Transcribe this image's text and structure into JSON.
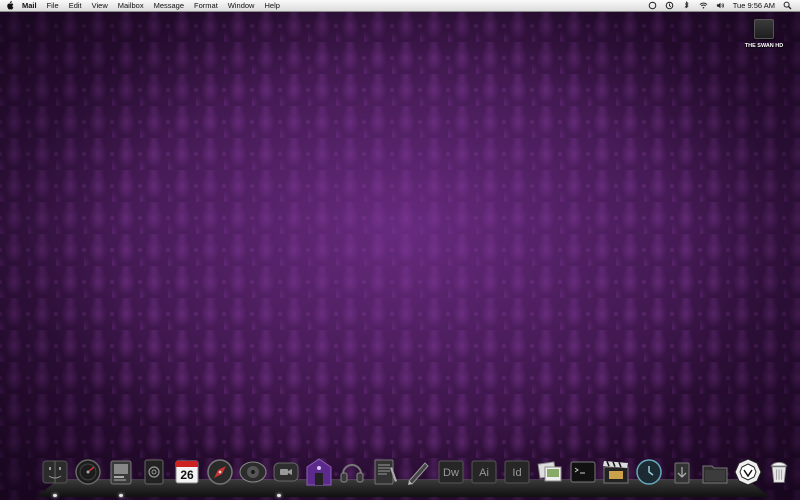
{
  "menubar": {
    "app_name": "Mail",
    "menus": [
      "File",
      "Edit",
      "View",
      "Mailbox",
      "Message",
      "Format",
      "Window",
      "Help"
    ],
    "status": {
      "datetime": "Tue 9:56 AM",
      "icons": [
        "sync-icon",
        "time-machine-icon",
        "bluetooth-icon",
        "wifi-icon",
        "volume-icon",
        "spotlight-icon"
      ]
    }
  },
  "desktop": {
    "drive_label": "THE SWAN HD"
  },
  "dock": {
    "items": [
      {
        "name": "finder"
      },
      {
        "name": "dashboard"
      },
      {
        "name": "preview"
      },
      {
        "name": "mail"
      },
      {
        "name": "ical"
      },
      {
        "name": "safari"
      },
      {
        "name": "itunes"
      },
      {
        "name": "facetime"
      },
      {
        "name": "app-store"
      },
      {
        "name": "headphones"
      },
      {
        "name": "textedit"
      },
      {
        "name": "pen-tool"
      },
      {
        "name": "dreamweaver",
        "text": "Dw"
      },
      {
        "name": "illustrator",
        "text": "Ai"
      },
      {
        "name": "indesign",
        "text": "Id"
      },
      {
        "name": "photos"
      },
      {
        "name": "terminal"
      },
      {
        "name": "final-cut"
      },
      {
        "name": "time-machine"
      },
      {
        "name": "downloads-stack"
      },
      {
        "name": "folder-stack"
      },
      {
        "name": "dharma-logo"
      },
      {
        "name": "trash"
      }
    ],
    "calendar_day": "26"
  },
  "colors": {
    "wallpaper_base": "#2a0f33",
    "wallpaper_pattern": "#783790",
    "menubar": "#e8e8e8"
  }
}
